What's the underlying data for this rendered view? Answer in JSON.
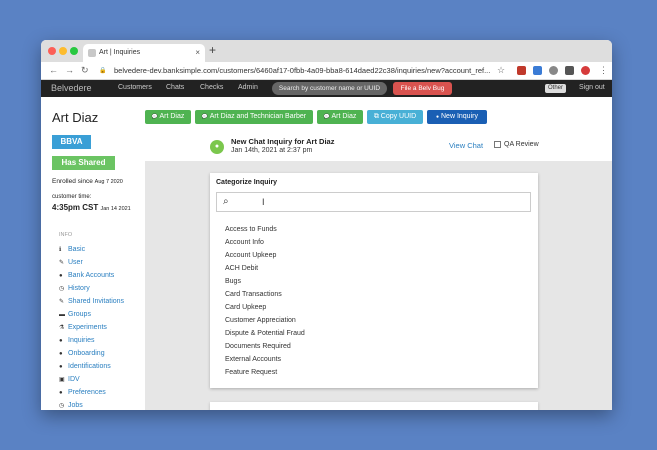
{
  "browser": {
    "tab_title": "Art | Inquiries",
    "tab_close": "×",
    "new_tab": "+",
    "url": "belvedere-dev.banksimple.com/customers/6460af17-0fbb-4a09-bba8-614daed22c38/inquiries/new?account_ref...",
    "back": "←",
    "forward": "→",
    "reload": "↻",
    "lock": "🔒",
    "star": "☆",
    "menu": "⋮"
  },
  "topnav": {
    "brand": "Belvedere",
    "links": [
      "Customers",
      "Chats",
      "Checks",
      "Admin"
    ],
    "search_placeholder": "Search by customer name or UUID",
    "bug_button": "File a Belv Bug",
    "env_badge": "Other",
    "sign_out": "Sign out"
  },
  "customer": {
    "name": "Art Diaz",
    "bank_badge": "BBVA",
    "shared_badge": "Has Shared",
    "enrolled_label": "Enrolled",
    "enrolled_since": "since",
    "enrolled_date": "Aug 7 2020",
    "time_label": "customer time:",
    "time": "4:35pm CST",
    "time_date": "Jan 14 2021"
  },
  "sidebar": {
    "header": "INFO",
    "items": [
      {
        "label": "Basic",
        "icon": "ℹ"
      },
      {
        "label": "User",
        "icon": "✎"
      },
      {
        "label": "Bank Accounts",
        "icon": "●"
      },
      {
        "label": "History",
        "icon": "◷"
      },
      {
        "label": "Shared Invitations",
        "icon": "✎"
      },
      {
        "label": "Groups",
        "icon": "▬"
      },
      {
        "label": "Experiments",
        "icon": "⚗"
      },
      {
        "label": "Inquiries",
        "icon": "●"
      },
      {
        "label": "Onboarding",
        "icon": "●"
      },
      {
        "label": "Identifications",
        "icon": "●"
      },
      {
        "label": "IDV",
        "icon": "▣"
      },
      {
        "label": "Preferences",
        "icon": "●"
      },
      {
        "label": "Jobs",
        "icon": "◷"
      }
    ]
  },
  "actions": {
    "btn1": "Art Diaz",
    "btn2": "Art Diaz and Technician Barber",
    "btn3": "Art Diaz",
    "btn4": "Copy UUID",
    "btn5": "New Inquiry",
    "chat_icon": "💬",
    "copy_icon": "⧉",
    "new_icon": "●"
  },
  "chat": {
    "title": "New Chat Inquiry for Art Diaz",
    "date": "Jan 14th, 2021 at 2:37 pm",
    "view_chat": "View Chat",
    "qa_review": "QA Review"
  },
  "inquiry": {
    "title": "Categorize Inquiry",
    "search_icon": "⌕",
    "cursor": "I",
    "categories": [
      "Access to Funds",
      "Account Info",
      "Account Upkeep",
      "ACH Debit",
      "Bugs",
      "Card Transactions",
      "Card Upkeep",
      "Customer Appreciation",
      "Dispute & Potential Fraud",
      "Documents Required",
      "External Accounts",
      "Feature Request"
    ]
  },
  "colors": {
    "desktop": "#5a82c4",
    "nav": "#222222",
    "green": "#4fb351",
    "blue": "#1a5fb4",
    "link": "#2a7fc0"
  }
}
